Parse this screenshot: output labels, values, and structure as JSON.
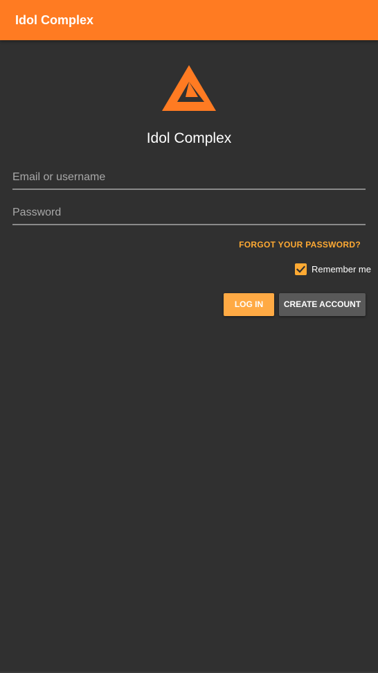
{
  "appbar": {
    "title": "Idol Complex"
  },
  "header": {
    "logo_icon": "idol-complex-triangle-logo",
    "app_name": "Idol Complex"
  },
  "form": {
    "email_placeholder": "Email or username",
    "email_value": "",
    "password_placeholder": "Password",
    "password_value": "",
    "forgot_password_label": "FORGOT YOUR PASSWORD?",
    "remember_me_label": "Remember me",
    "remember_me_checked": true
  },
  "actions": {
    "login_label": "LOG IN",
    "create_account_label": "CREATE ACCOUNT"
  },
  "colors": {
    "appbar": "#ff7b22",
    "background": "#303030",
    "accent": "#ffaa33",
    "secondary_button": "#595959"
  }
}
